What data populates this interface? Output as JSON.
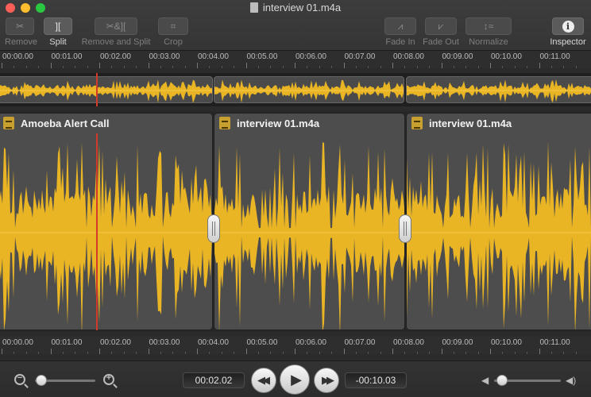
{
  "window": {
    "title": "interview 01.m4a"
  },
  "toolbar": {
    "buttons": [
      {
        "id": "remove",
        "label": "Remove",
        "icon": "scissors-icon",
        "glyph": "✂",
        "enabled": false
      },
      {
        "id": "split",
        "label": "Split",
        "icon": "split-icon",
        "glyph": "][",
        "enabled": true
      },
      {
        "id": "remove-split",
        "label": "Remove and Split",
        "icon": "remove-split-icon",
        "glyph": "✂&][",
        "enabled": false
      },
      {
        "id": "crop",
        "label": "Crop",
        "icon": "crop-icon",
        "glyph": "⌗",
        "enabled": false
      },
      {
        "id": "fade-in",
        "label": "Fade In",
        "icon": "fade-in-icon",
        "glyph": "⩘",
        "enabled": false
      },
      {
        "id": "fade-out",
        "label": "Fade Out",
        "icon": "fade-out-icon",
        "glyph": "⩗",
        "enabled": false
      },
      {
        "id": "normalize",
        "label": "Normalize",
        "icon": "normalize-icon",
        "glyph": "↕≈",
        "enabled": false
      },
      {
        "id": "inspector",
        "label": "Inspector",
        "icon": "info-icon",
        "glyph": "i",
        "enabled": true
      }
    ]
  },
  "ruler": {
    "labels": [
      "00:00.00",
      "00:01.00",
      "00:02.00",
      "00:03.00",
      "00:04.00",
      "00:05.00",
      "00:06.00",
      "00:07.00",
      "00:08.00",
      "00:09.00",
      "00:10.00",
      "00:11.00"
    ]
  },
  "clips": [
    {
      "title": "Amoeba Alert Call",
      "icon": "audio-file-icon"
    },
    {
      "title": "interview 01.m4a",
      "icon": "audio-file-icon"
    },
    {
      "title": "interview 01.m4a",
      "icon": "audio-file-icon"
    }
  ],
  "transport": {
    "current_time": "00:02.02",
    "remaining_time": "-00:10.03",
    "zoom_level": 0.1,
    "volume_level": 0.12,
    "zoom_out_icon": "zoom-out-icon",
    "zoom_in_icon": "zoom-in-icon",
    "rewind_icon": "rewind-icon",
    "play_icon": "play-icon",
    "forward_icon": "fast-forward-icon",
    "volume_low_icon": "speaker-low-icon",
    "volume_high_icon": "speaker-high-icon"
  },
  "colors": {
    "waveform": "#e9b524",
    "playhead": "#d23a2a",
    "clip_bg": "#4d4d4d"
  }
}
